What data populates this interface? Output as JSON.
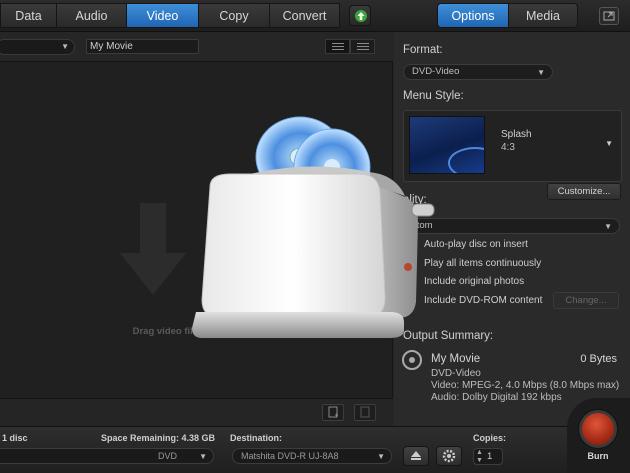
{
  "toolbar": {
    "tabs": [
      {
        "label": "Data",
        "active": false
      },
      {
        "label": "Audio",
        "active": false
      },
      {
        "label": "Video",
        "active": true
      },
      {
        "label": "Copy",
        "active": false
      },
      {
        "label": "Convert",
        "active": false
      }
    ],
    "right_tabs": [
      {
        "label": "Options",
        "active": true
      },
      {
        "label": "Media",
        "active": false
      }
    ],
    "accent_color": "#2f7fd0"
  },
  "left": {
    "title_value": "My Movie",
    "drop_hint": "Drag video files or pictures i"
  },
  "options": {
    "format_label": "Format:",
    "format_value": "DVD-Video",
    "menu_style_label": "Menu Style:",
    "menu_style_name": "Splash",
    "menu_style_ratio": "4:3",
    "customize_label": "Customize...",
    "quality_label": "ality:",
    "quality_value": "stom",
    "checks": [
      {
        "label": "Auto-play disc on insert"
      },
      {
        "label": "Play all items continuously"
      },
      {
        "label": "Include original photos"
      },
      {
        "label": "Include DVD-ROM content"
      }
    ],
    "change_label": "Change...",
    "summary_label": "Output Summary:",
    "summary_title": "My Movie",
    "summary_size": "0 Bytes",
    "summary_format": "DVD-Video",
    "summary_video": "Video: MPEG-2, 4.0 Mbps (8.0 Mbps max)",
    "summary_audio": "Audio: Dolby Digital 192 kbps"
  },
  "bottom": {
    "disc_count": "1 disc",
    "space_label": "Space Remaining: 4.38 GB",
    "disc_type": "DVD",
    "destination_label": "Destination:",
    "destination_value": "Matshita DVD-R   UJ-8A8",
    "copies_label": "Copies:",
    "copies_value": "1",
    "burn_label": "Burn",
    "burn_color": "#c0381f"
  }
}
